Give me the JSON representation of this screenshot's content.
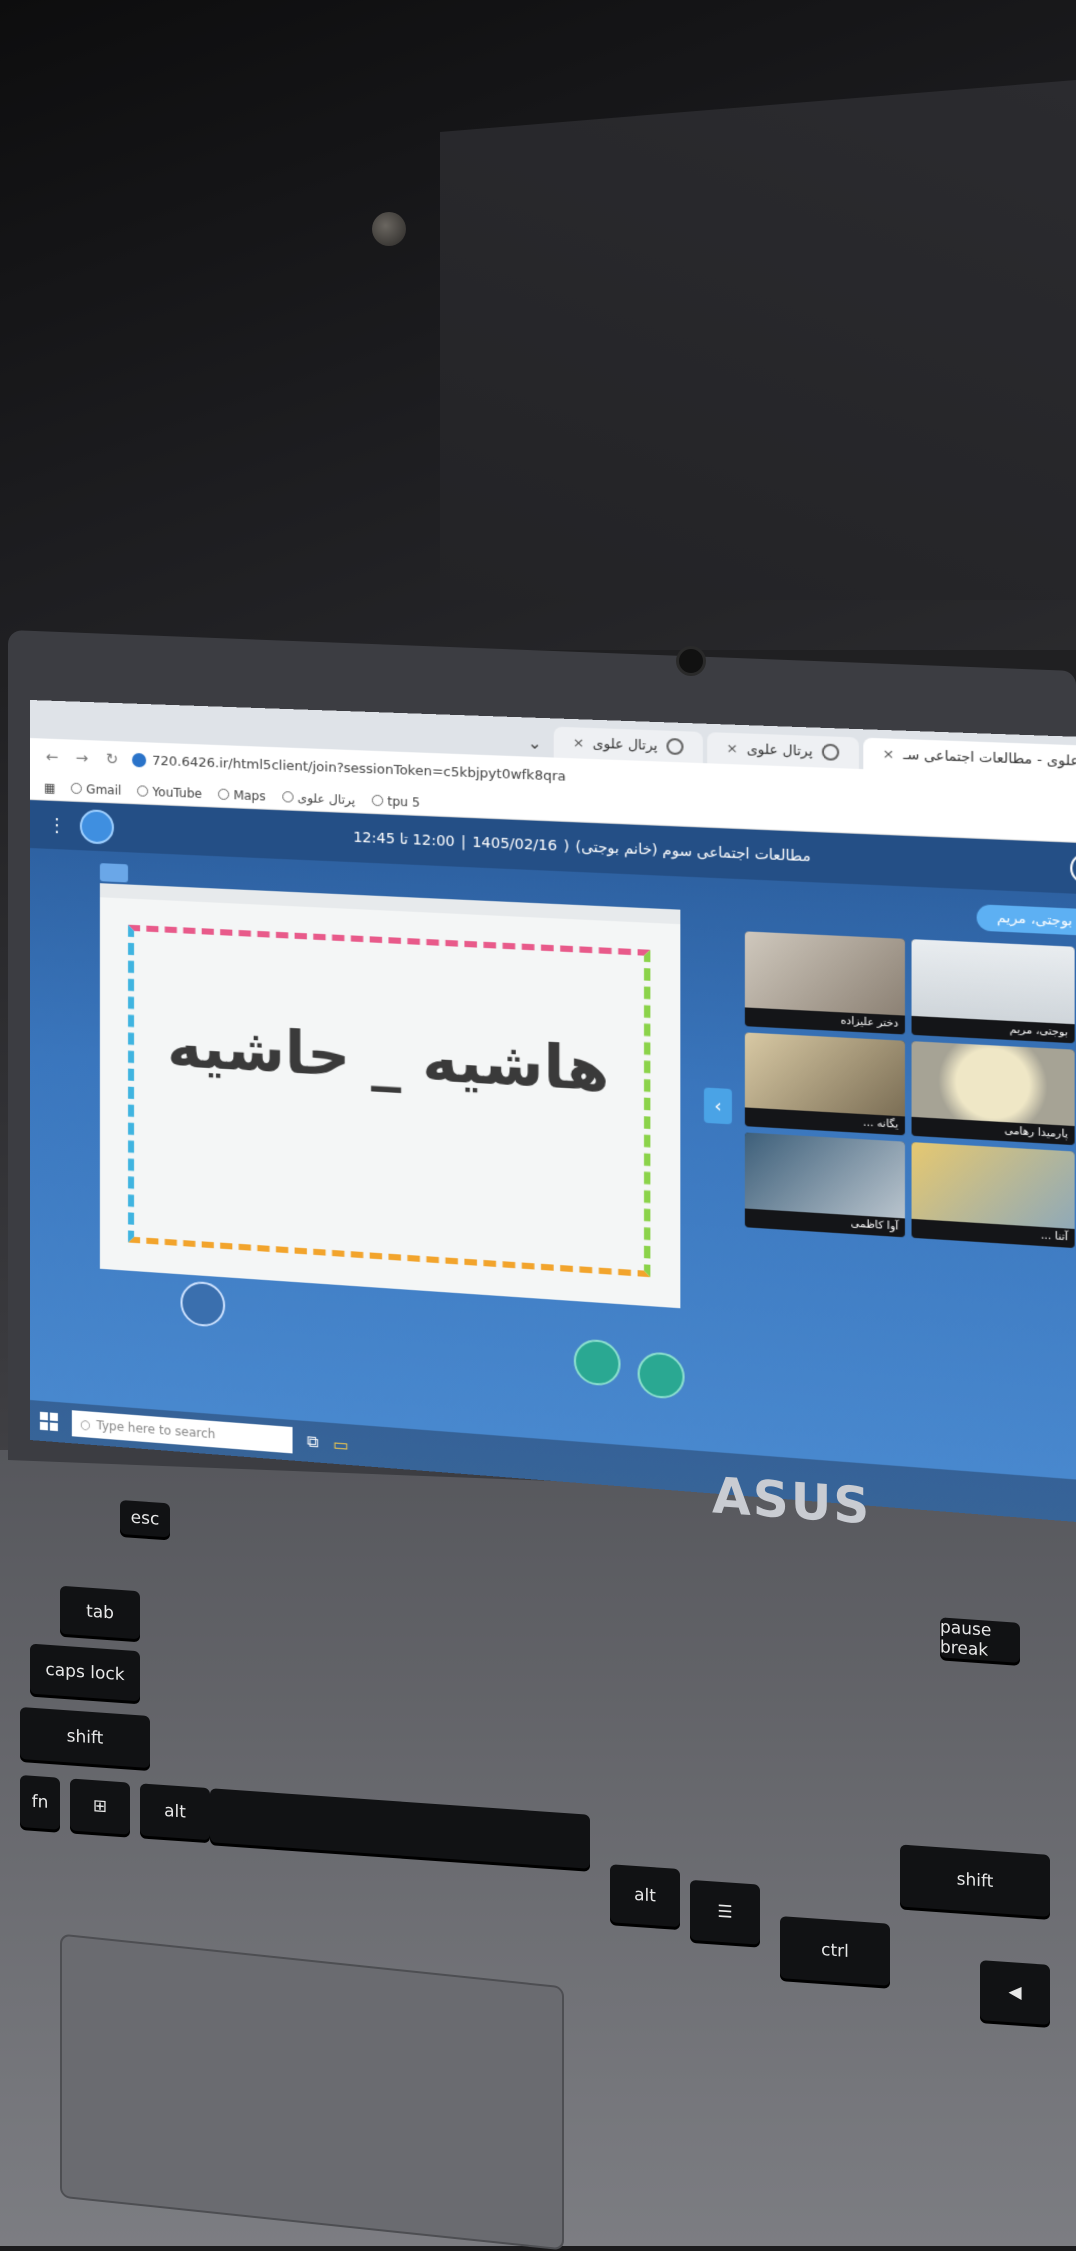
{
  "browser": {
    "tabs": [
      {
        "label": "علوی - مطالعات اجتماعی سـ",
        "active": true,
        "favicon": "record-icon"
      },
      {
        "label": "پرتال علوی",
        "active": false,
        "favicon": "globe-icon"
      },
      {
        "label": "پرتال علوی",
        "active": false,
        "favicon": "globe-icon"
      }
    ],
    "url": "720.6426.ir/html5client/join?sessionToken=c5kbjpyt0wfk8qra",
    "bookmarks": [
      "Gmail",
      "YouTube",
      "Maps",
      "پرتال علوی",
      "tpu 5"
    ]
  },
  "session": {
    "title": "مطالعات اجتماعی سوم (خانم بوجتی)",
    "date": "1405/02/16",
    "time": "12:00 تا 12:45",
    "presenter_badge": "بوجتی، مریم"
  },
  "slide": {
    "text": "هاشیه _ حاشیه"
  },
  "participants": [
    {
      "name": "دختر علیزاده"
    },
    {
      "name": "بوجتی، مریم"
    },
    {
      "name": "یگانه ..."
    },
    {
      "name": "پارمیدا رهامی"
    },
    {
      "name": "آوا کاظمی"
    },
    {
      "name": "آتنا ..."
    }
  ],
  "taskbar": {
    "search_placeholder": "Type here to search"
  },
  "laptop": {
    "brand": "ASUS",
    "keys": [
      "esc",
      "tab",
      "caps lock",
      "shift",
      "fn",
      "alt",
      "ctrl",
      "pause break",
      "alt",
      "ctrl",
      "shift"
    ]
  },
  "colors": {
    "app_bg": "#3a76bd",
    "appbar": "#244f86",
    "badge": "#5db0f3",
    "accent_green": "#2aa892"
  }
}
